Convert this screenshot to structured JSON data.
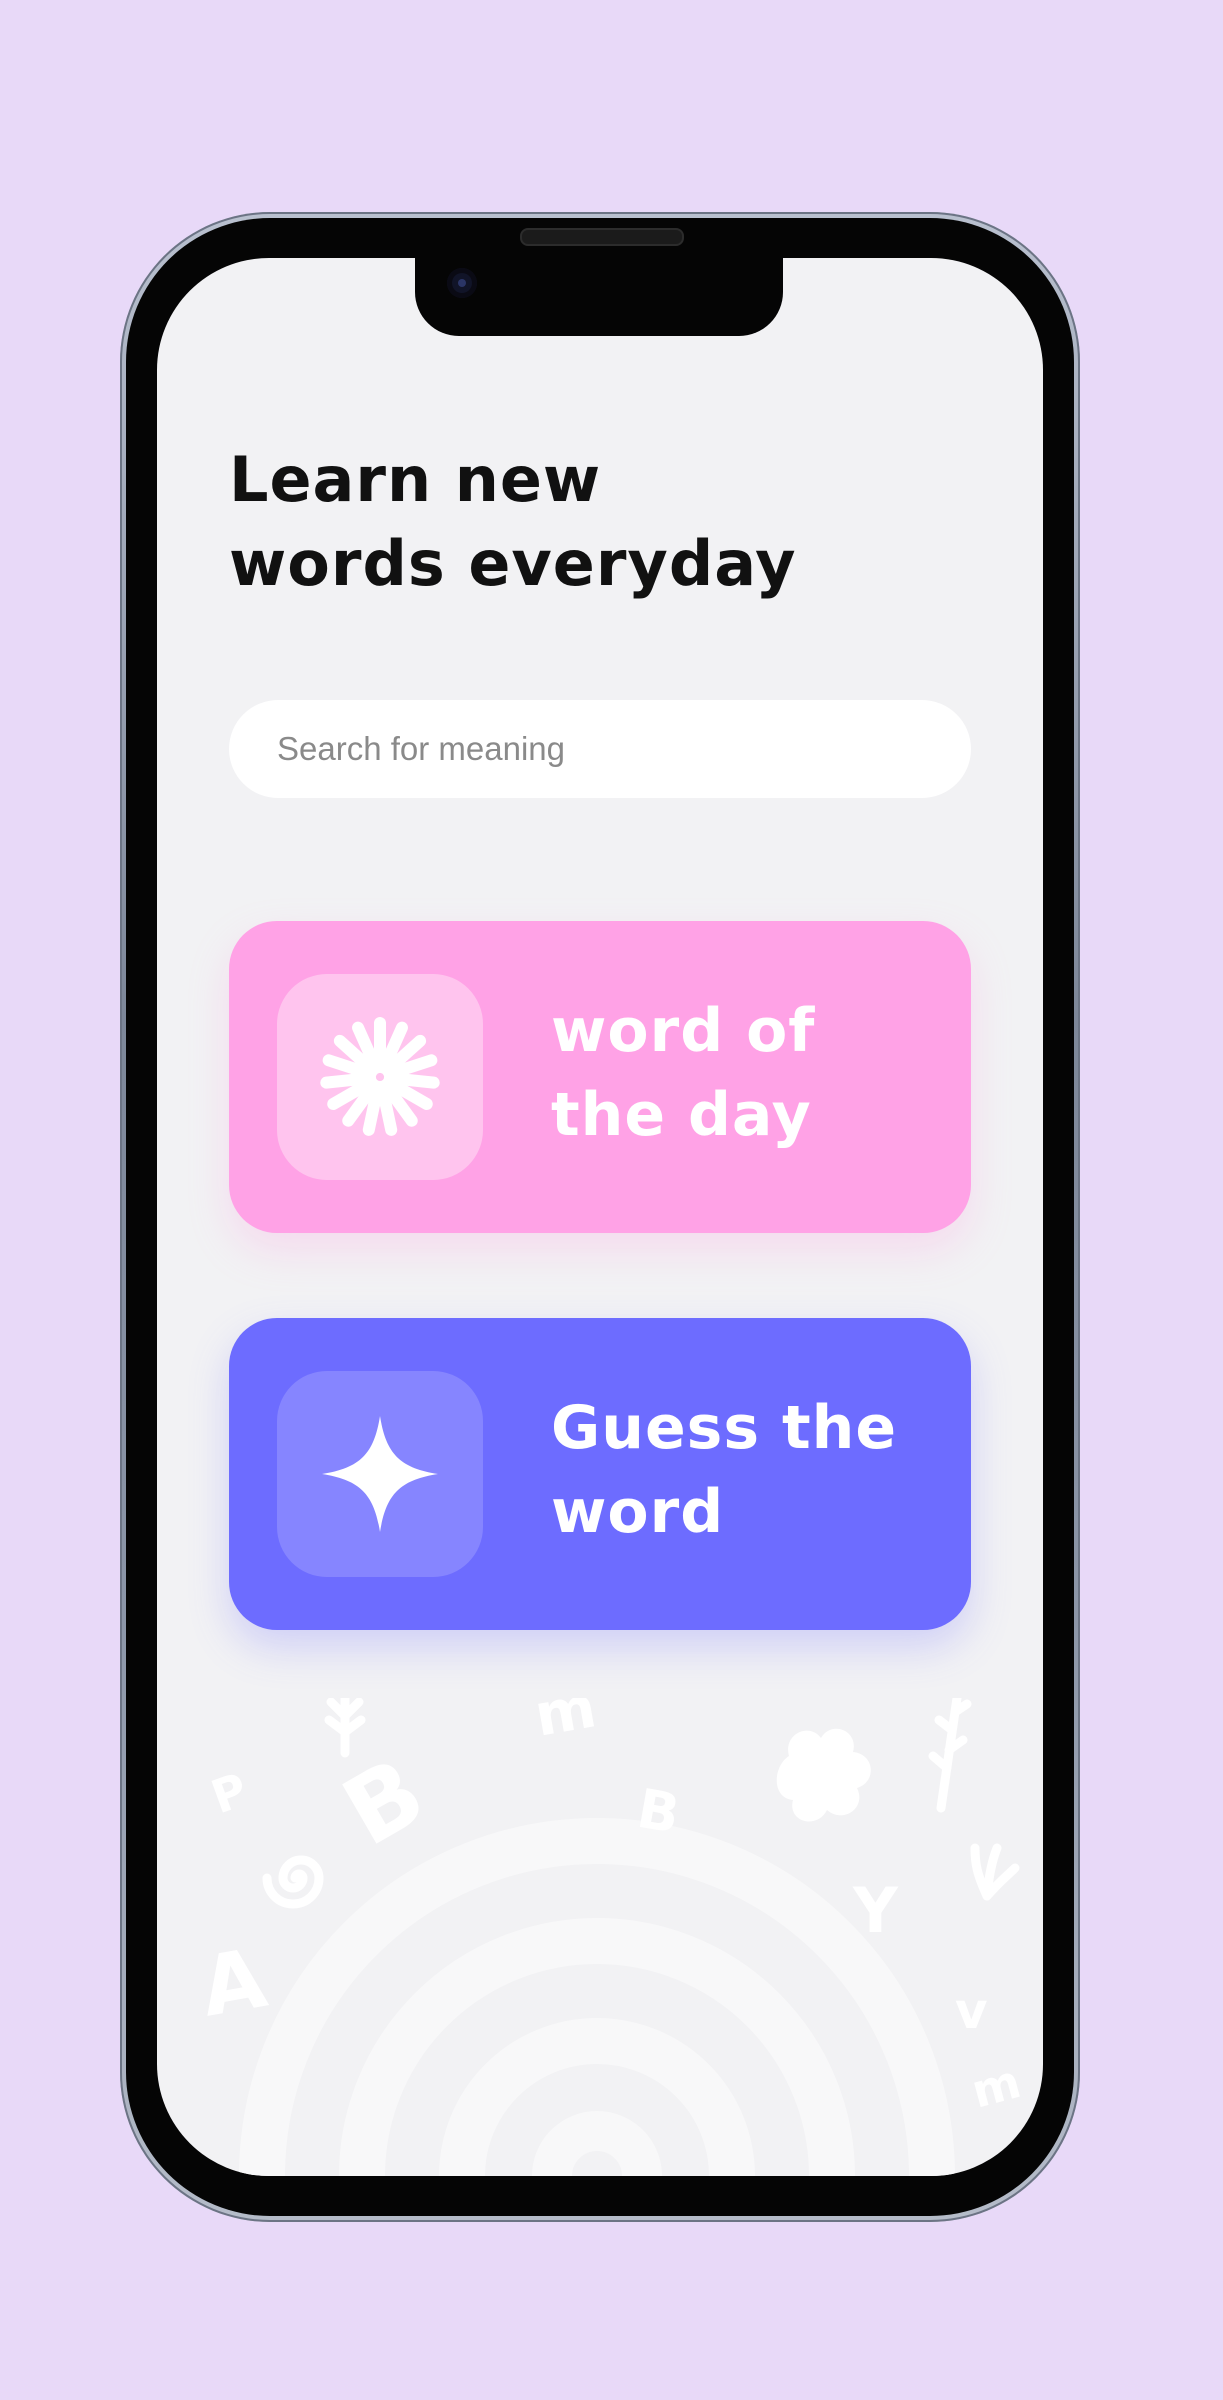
{
  "app": {
    "headline_line1": "Learn new",
    "headline_line2": "words everyday"
  },
  "search": {
    "placeholder": "Search for meaning",
    "value": ""
  },
  "cards": [
    {
      "line1": "word of",
      "line2": "the day",
      "icon": "flower-burst-icon",
      "color": "#ffa2e6"
    },
    {
      "line1": "Guess the",
      "line2": "word",
      "icon": "sparkle-star-icon",
      "color": "#6d6cff"
    }
  ],
  "decor": {
    "letters": [
      "P",
      "B",
      "A",
      "m",
      "B",
      "Y",
      "v",
      "m"
    ]
  },
  "colors": {
    "background": "#e8d9f8",
    "screen": "#f2f2f4",
    "pink": "#ffa2e6",
    "indigo": "#6d6cff"
  }
}
